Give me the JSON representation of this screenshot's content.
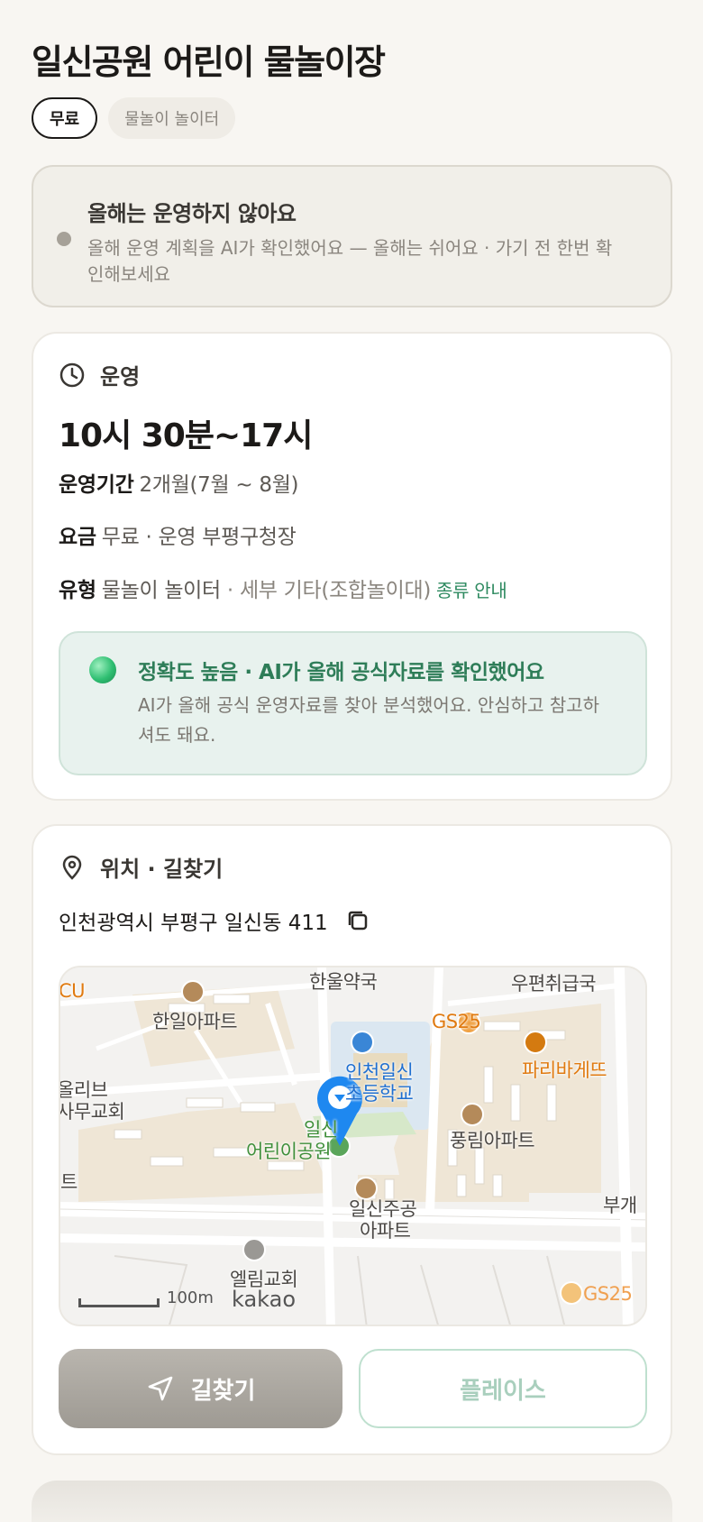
{
  "page": {
    "title": "일신공원 어린이 물놀이장"
  },
  "chips": [
    {
      "label": "무료"
    },
    {
      "label": "물놀이 놀이터"
    }
  ],
  "notice": {
    "title": "올해는 운영하지 않아요",
    "body": "올해 운영 계획을 AI가 확인했어요 — 올해는 쉬어요 · 가기 전 한번 확인해보세요"
  },
  "operation": {
    "heading": "운영",
    "hours": "10시 30분~17시",
    "period_label": "운영기간",
    "period_value": "2개월(7월 ~ 8월)",
    "fee_label": "요금",
    "fee_value": "무료 · 운영 부평구청장",
    "type_label": "유형",
    "type_value": "물놀이 놀이터",
    "type_detail": " · 세부 기타(조합놀이대)",
    "type_link": "종류 안내"
  },
  "accuracy": {
    "title": "정확도 높음 · AI가 올해 공식자료를 확인했어요",
    "body": "AI가 올해 공식 운영자료를 찾아 분석했어요. 안심하고 참고하셔도 돼요."
  },
  "location": {
    "heading": "위치 · 길찾기",
    "address": "인천광역시 부평구 일신동 411"
  },
  "map": {
    "labels": {
      "cu": "CU",
      "hanul": "한울약국",
      "post": "우편취급국",
      "hanil": "한일아파트",
      "gs25_top": "GS25",
      "paris": "파리바게뜨",
      "school1": "인천일신",
      "school2": "초등학교",
      "olive1": "올리브",
      "olive2": "사무교회",
      "park1": "일신",
      "park2": "어린이공원",
      "pungrim": "풍림아파트",
      "te": "트",
      "jugong1": "일신주공",
      "jugong2": "아파트",
      "bugae": "부개",
      "elim": "엘림교회",
      "gs25_bottom": "GS25",
      "scale": "100m",
      "kakao": "kakao"
    }
  },
  "actions": {
    "directions": "길찾기",
    "place": "플레이스"
  },
  "colors": {
    "accent_green": "#2e8a60",
    "marker_blue": "#1e88f0",
    "background": "#f8f6f2"
  }
}
